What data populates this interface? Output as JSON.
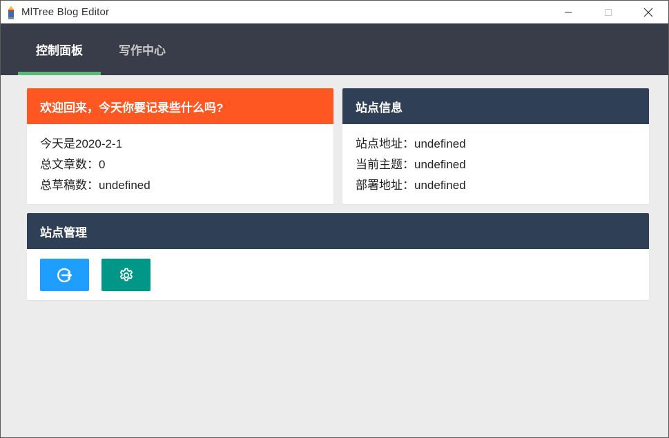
{
  "window": {
    "title": "MlTree Blog Editor"
  },
  "nav": {
    "tabs": [
      {
        "label": "控制面板",
        "active": true
      },
      {
        "label": "写作中心",
        "active": false
      }
    ]
  },
  "welcome": {
    "header": "欢迎回来，今天你要记录些什么吗?",
    "lines": [
      "今天是2020-2-1",
      "总文章数：0",
      "总草稿数：undefined"
    ]
  },
  "site_info": {
    "header": "站点信息",
    "lines": [
      "站点地址：undefined",
      "当前主题：undefined",
      "部署地址：undefined"
    ]
  },
  "site_manage": {
    "header": "站点管理",
    "buttons": [
      {
        "icon": "deploy-icon"
      },
      {
        "icon": "gear-icon"
      }
    ]
  },
  "colors": {
    "navbar": "#393d49",
    "tab_active_indicator": "#5fb878",
    "welcome_header": "#ff5722",
    "info_header": "#2f4056",
    "deploy_button": "#1e9fff",
    "settings_button": "#009688"
  }
}
